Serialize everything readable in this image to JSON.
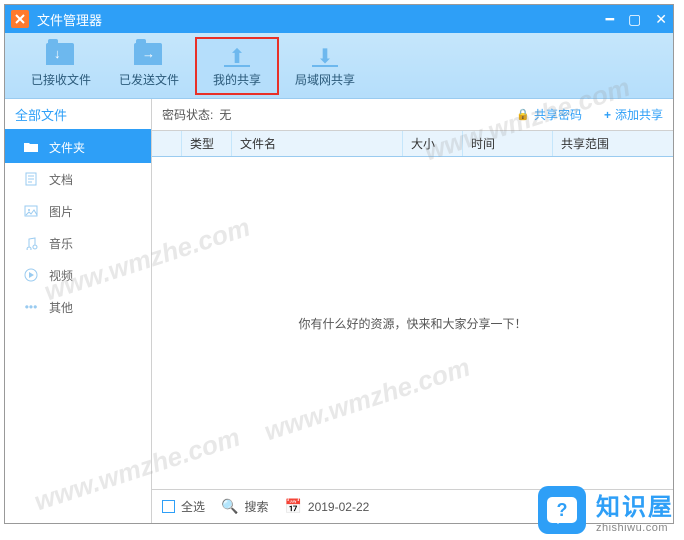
{
  "titlebar": {
    "title": "文件管理器"
  },
  "toolbar": {
    "items": [
      {
        "label": "已接收文件"
      },
      {
        "label": "已发送文件"
      },
      {
        "label": "我的共享"
      },
      {
        "label": "局域网共享"
      }
    ]
  },
  "sidebar": {
    "header": "全部文件",
    "items": [
      {
        "label": "文件夹"
      },
      {
        "label": "文档"
      },
      {
        "label": "图片"
      },
      {
        "label": "音乐"
      },
      {
        "label": "视频"
      },
      {
        "label": "其他"
      }
    ]
  },
  "status": {
    "label": "密码状态:",
    "value": "无",
    "share_password": "共享密码",
    "add_share": "添加共享"
  },
  "table": {
    "headers": {
      "type": "类型",
      "name": "文件名",
      "size": "大小",
      "time": "时间",
      "scope": "共享范围"
    },
    "empty_message": "你有什么好的资源，快来和大家分享一下！"
  },
  "bottombar": {
    "select_all": "全选",
    "search": "搜索",
    "date": "2019-02-22"
  },
  "watermarks": [
    "www.wmzhe.com",
    "www.wmzhe.com",
    "www.wmzhe.com",
    "www.wmzhe.com"
  ],
  "badge": {
    "title": "知识屋",
    "sub": "zhishiwu.com"
  }
}
